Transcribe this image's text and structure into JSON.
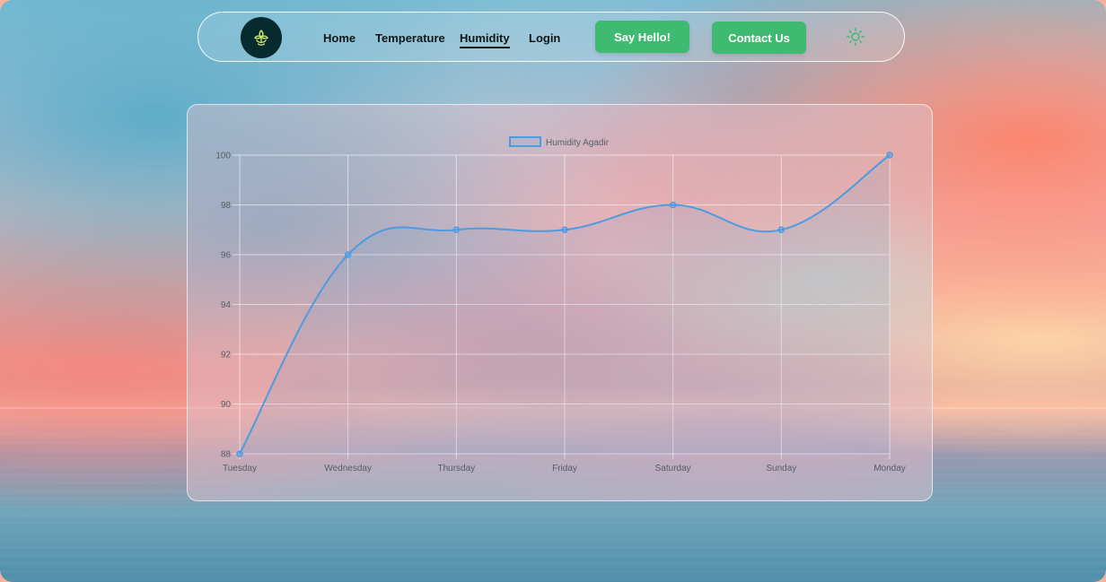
{
  "nav": {
    "links": [
      {
        "label": "Home",
        "active": false
      },
      {
        "label": "Temperature",
        "active": false
      },
      {
        "label": "Humidity",
        "active": true
      },
      {
        "label": "Login",
        "active": false
      }
    ],
    "buttons": {
      "say_hello": "Say Hello!",
      "contact": "Contact Us"
    },
    "icons": {
      "logo": "plant-icon",
      "theme_toggle": "sun-icon"
    }
  },
  "colors": {
    "accent": "#3ebb71",
    "logo_background": "#072a2f",
    "line": "#4d9be0",
    "fill": "rgba(77,155,224,0.12)"
  },
  "chart_data": {
    "type": "line",
    "categories": [
      "Tuesday",
      "Wednesday",
      "Thursday",
      "Friday",
      "Saturday",
      "Sunday",
      "Monday"
    ],
    "series": [
      {
        "name": "Humidity Agadir",
        "values": [
          88,
          96,
          97,
          97,
          98,
          97,
          100
        ]
      }
    ],
    "ylim": [
      88,
      100
    ],
    "yticks": [
      88,
      90,
      92,
      94,
      96,
      98,
      100
    ],
    "grid": true,
    "legend_position": "top-center",
    "smooth": true,
    "filled": true
  }
}
